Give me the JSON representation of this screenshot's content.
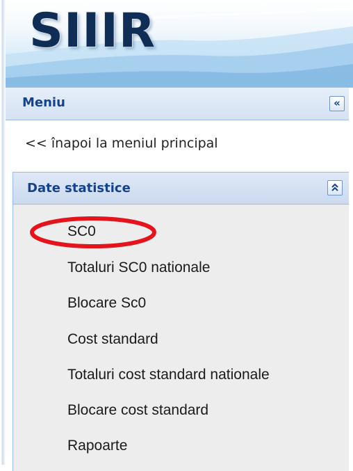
{
  "header": {
    "logo_text": "SIIIR"
  },
  "menu_panel": {
    "title": "Meniu",
    "collapse_glyph": "«",
    "back_link": "<< înapoi la meniul principal"
  },
  "section": {
    "title": "Date statistice",
    "expand_glyph": "⌃",
    "items": [
      "SC0",
      "Totaluri SC0 nationale",
      "Blocare Sc0",
      "Cost standard",
      "Totaluri cost standard nationale",
      "Blocare cost standard",
      "Rapoarte"
    ]
  },
  "annotation": {
    "type": "highlight-ellipse",
    "target_item": "SC0",
    "color": "#e3141c"
  },
  "colors": {
    "panel_title": "#15428b",
    "panel_border": "#99bbe8",
    "logo": "#0f2d55",
    "menu_background": "#ededed"
  }
}
